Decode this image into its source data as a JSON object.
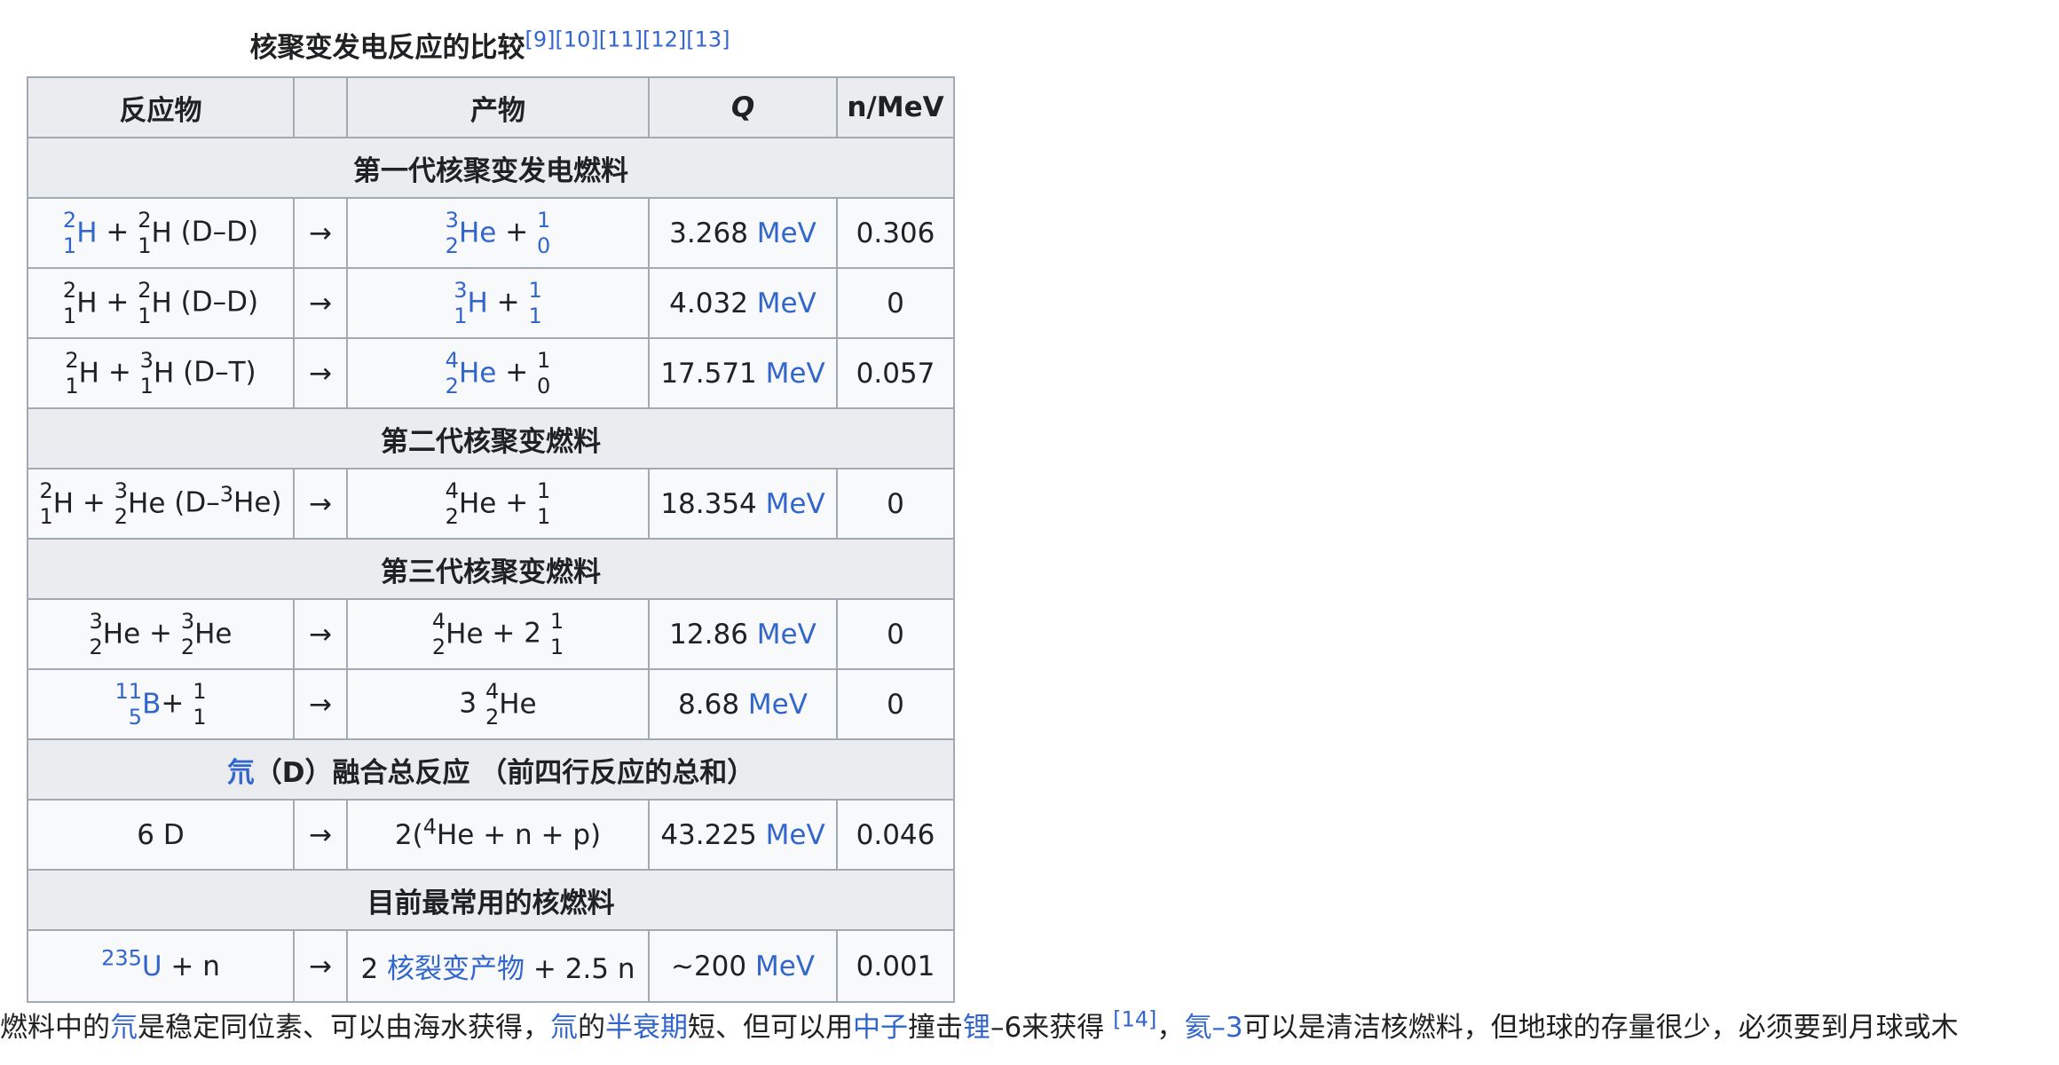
{
  "caption": {
    "text": "核聚变发电反应的比较",
    "refs": [
      "[9]",
      "[10]",
      "[11]",
      "[12]",
      "[13]"
    ]
  },
  "table": {
    "headers": {
      "reactants": "反应物",
      "arrow": "",
      "products": "产物",
      "q": "Q",
      "n_per_mev": "n/MeV"
    },
    "groups": [
      {
        "title": "第一代核聚变发电燃料",
        "rows": [
          {
            "reactants": [
              {
                "mass": "2",
                "z": "1",
                "sym": "H",
                "link": true
              },
              {
                "text": " + "
              },
              {
                "mass": "2",
                "z": "1",
                "sym": "H"
              },
              {
                "text": " (D–D)"
              }
            ],
            "arrow": "→",
            "products": [
              {
                "mass": "3",
                "z": "2",
                "sym": "He",
                "link": true
              },
              {
                "text": " + "
              },
              {
                "mass": "1",
                "z": "0",
                "sym": "",
                "link": true
              }
            ],
            "q_value": "3.268",
            "q_unit": "MeV",
            "n": "0.306"
          },
          {
            "reactants": [
              {
                "mass": "2",
                "z": "1",
                "sym": "H"
              },
              {
                "text": " + "
              },
              {
                "mass": "2",
                "z": "1",
                "sym": "H"
              },
              {
                "text": " (D–D)"
              }
            ],
            "arrow": "→",
            "products": [
              {
                "mass": "3",
                "z": "1",
                "sym": "H",
                "link": true
              },
              {
                "text": " + "
              },
              {
                "mass": "1",
                "z": "1",
                "sym": "",
                "link": true
              }
            ],
            "q_value": "4.032",
            "q_unit": "MeV",
            "n": "0"
          },
          {
            "reactants": [
              {
                "mass": "2",
                "z": "1",
                "sym": "H"
              },
              {
                "text": " + "
              },
              {
                "mass": "3",
                "z": "1",
                "sym": "H"
              },
              {
                "text": " (D–T)"
              }
            ],
            "arrow": "→",
            "products": [
              {
                "mass": "4",
                "z": "2",
                "sym": "He",
                "link": true
              },
              {
                "text": " + "
              },
              {
                "mass": "1",
                "z": "0",
                "sym": ""
              }
            ],
            "q_value": "17.571",
            "q_unit": "MeV",
            "n": "0.057"
          }
        ]
      },
      {
        "title": "第二代核聚变燃料",
        "rows": [
          {
            "reactants": [
              {
                "mass": "2",
                "z": "1",
                "sym": "H"
              },
              {
                "text": " + "
              },
              {
                "mass": "3",
                "z": "2",
                "sym": "He"
              },
              {
                "text": " (D–"
              },
              {
                "sup": "3"
              },
              {
                "text": "He)"
              }
            ],
            "arrow": "→",
            "products": [
              {
                "mass": "4",
                "z": "2",
                "sym": "He"
              },
              {
                "text": " + "
              },
              {
                "mass": "1",
                "z": "1",
                "sym": ""
              }
            ],
            "q_value": "18.354",
            "q_unit": "MeV",
            "n": "0"
          }
        ]
      },
      {
        "title": "第三代核聚变燃料",
        "rows": [
          {
            "reactants": [
              {
                "mass": "3",
                "z": "2",
                "sym": "He"
              },
              {
                "text": " + "
              },
              {
                "mass": "3",
                "z": "2",
                "sym": "He"
              }
            ],
            "arrow": "→",
            "products": [
              {
                "mass": "4",
                "z": "2",
                "sym": "He"
              },
              {
                "text": " + 2 "
              },
              {
                "mass": "1",
                "z": "1",
                "sym": ""
              }
            ],
            "q_value": "12.86",
            "q_unit": "MeV",
            "n": "0"
          },
          {
            "reactants": [
              {
                "mass": "11",
                "z": "5",
                "sym": "B",
                "link": true
              },
              {
                "text": "+ "
              },
              {
                "mass": "1",
                "z": "1",
                "sym": ""
              }
            ],
            "arrow": "→",
            "products": [
              {
                "text": "3 "
              },
              {
                "mass": "4",
                "z": "2",
                "sym": "He"
              }
            ],
            "q_value": "8.68",
            "q_unit": "MeV",
            "n": "0"
          }
        ]
      },
      {
        "title_link": "氘",
        "title": "（D）融合总反应 （前四行反应的总和）",
        "rows": [
          {
            "reactants": [
              {
                "text": "6 D"
              }
            ],
            "arrow": "→",
            "products": [
              {
                "text": "2("
              },
              {
                "sup": "4"
              },
              {
                "text": "He + n + p)"
              }
            ],
            "q_value": "43.225",
            "q_unit": "MeV",
            "n": "0.046"
          }
        ]
      },
      {
        "title": "目前最常用的核燃料",
        "rows": [
          {
            "tall": true,
            "reactants": [
              {
                "sup": "235",
                "link": true
              },
              {
                "text": "U",
                "link": true
              },
              {
                "text": " + n"
              }
            ],
            "arrow": "→",
            "products": [
              {
                "text": "2 "
              },
              {
                "text": "核裂变产物",
                "link": true
              },
              {
                "text": " + 2.5 n"
              }
            ],
            "q_value": "~200",
            "q_unit": "MeV",
            "n": "0.001"
          }
        ]
      }
    ]
  },
  "paragraph": [
    {
      "text": "燃料中的"
    },
    {
      "text": "氘",
      "link": true
    },
    {
      "text": "是稳定同位素、可以由海水获得，"
    },
    {
      "text": "氚",
      "link": true
    },
    {
      "text": "的"
    },
    {
      "text": "半衰期",
      "link": true
    },
    {
      "text": "短、但可以用"
    },
    {
      "text": "中子",
      "link": true
    },
    {
      "text": "撞击"
    },
    {
      "text": "锂",
      "link": true
    },
    {
      "text": "–6来获得 "
    },
    {
      "sup": "[14]",
      "link": true
    },
    {
      "text": "，"
    },
    {
      "text": "氦–3",
      "link": true
    },
    {
      "text": "可以是清洁核燃料，但地球的存量很少，必须要到月球或木"
    }
  ]
}
